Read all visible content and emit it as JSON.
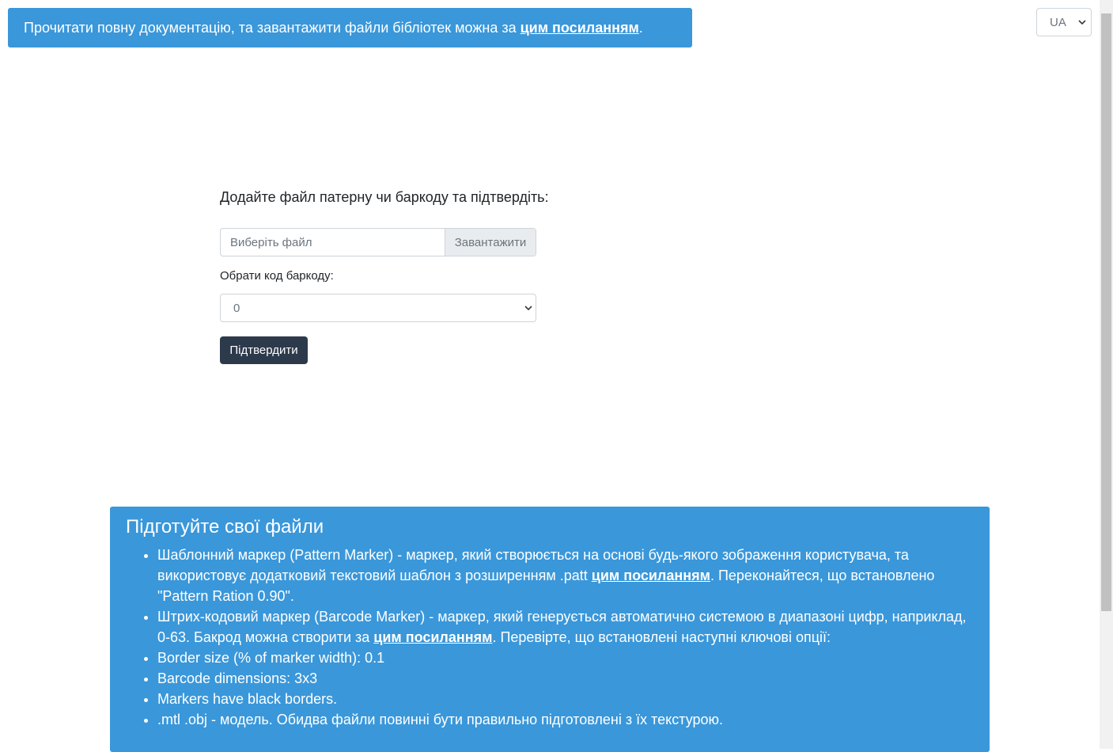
{
  "banner": {
    "text_before": "Прочитати повну документацію, та завантажити файли бібліотек можна за ",
    "link_text": "цим посиланням",
    "text_after": "."
  },
  "language": {
    "selected": "UA"
  },
  "form": {
    "prompt": "Додайте файл патерну чи баркоду та підтвердіть:",
    "file_placeholder": "Виберіть файл",
    "upload_button": "Завантажити",
    "barcode_label": "Обрати код баркоду:",
    "barcode_value": "0",
    "submit_button": "Підтвердити"
  },
  "info": {
    "title": "Підготуйте свої файли",
    "item1": {
      "before": "Шаблонний маркер (Pattern Marker) - маркер, який створюється на основі будь-якого зображення користувача, та використовує додатковий текстовий шаблон з розширенням .patt ",
      "link": "цим посиланням",
      "after": ". Переконайтеся, що встановлено \"Pattern Ration 0.90\"."
    },
    "item2": {
      "before": "Штрих-кодовий маркер (Barcode Marker) - маркер, який генерується автоматично системою в диапазоні цифр, наприклад, 0-63. Бакрод можна створити за ",
      "link": "цим посиланням",
      "after": ". Перевірте, що встановлені наступні ключові опції:"
    },
    "item3": "Border size (% of marker width): 0.1",
    "item4": "Barcode dimensions: 3x3",
    "item5": "Markers have black borders.",
    "item6": ".mtl .obj - модель. Обидва файли повинні бути правильно підготовлені з їх текстурою."
  },
  "colors": {
    "accent": "#3a97da",
    "button": "#2d3a4b"
  }
}
